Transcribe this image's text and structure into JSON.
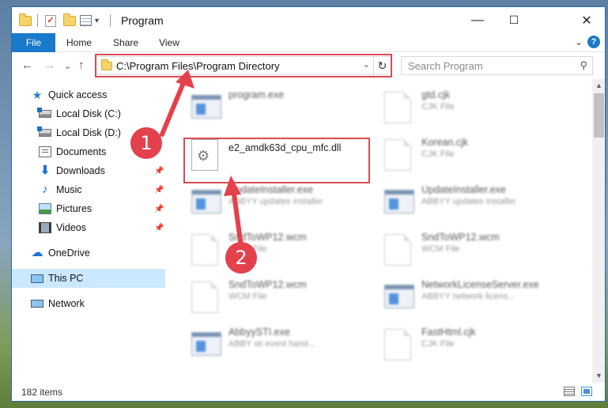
{
  "window": {
    "title": "Program",
    "controls": {
      "minimize": "—",
      "maximize": "☐",
      "close": "✕"
    }
  },
  "ribbon": {
    "tabs": [
      "File",
      "Home",
      "Share",
      "View"
    ],
    "expand_glyph": "⌄",
    "help_glyph": "?"
  },
  "navbar": {
    "back": "←",
    "forward": "→",
    "recent": "⌄",
    "up": "↑",
    "address": "C:\\Program Files\\Program Directory",
    "address_dropdown": "⌄",
    "refresh": "↻",
    "search_placeholder": "Search Program",
    "search_glyph": "⚲"
  },
  "sidebar": {
    "items": [
      {
        "label": "Quick access",
        "icon": "star-icon",
        "pinned": false
      },
      {
        "label": "Local Disk (C:)",
        "icon": "disk-icon",
        "pinned": false
      },
      {
        "label": "Local Disk (D:)",
        "icon": "disk-icon",
        "pinned": false
      },
      {
        "label": "Documents",
        "icon": "documents-icon",
        "pinned": false
      },
      {
        "label": "Downloads",
        "icon": "download-icon",
        "pinned": true
      },
      {
        "label": "Music",
        "icon": "music-icon",
        "pinned": true
      },
      {
        "label": "Pictures",
        "icon": "pictures-icon",
        "pinned": true
      },
      {
        "label": "Videos",
        "icon": "videos-icon",
        "pinned": true
      },
      {
        "label": "OneDrive",
        "icon": "cloud-icon",
        "pinned": false
      },
      {
        "label": "This PC",
        "icon": "computer-icon",
        "pinned": false,
        "selected": true
      },
      {
        "label": "Network",
        "icon": "network-icon",
        "pinned": false
      }
    ],
    "pin_glyph": "📌"
  },
  "files": [
    {
      "name": "program.exe",
      "desc": "",
      "icon": "exe-icon",
      "blurred": true
    },
    {
      "name": "gtd.cjk",
      "desc": "CJK File",
      "icon": "file-icon",
      "blurred": true
    },
    {
      "name": "e2_amdk63d_cpu_mfc.dll",
      "desc": "",
      "icon": "dll-icon",
      "blurred": false,
      "highlighted": true
    },
    {
      "name": "Korean.cjk",
      "desc": "CJK File",
      "icon": "file-icon",
      "blurred": true
    },
    {
      "name": "UpdateInstaller.exe",
      "desc": "ABBYY updates installer",
      "icon": "exe-icon",
      "blurred": true
    },
    {
      "name": "UpdateInstaller.exe",
      "desc": "ABBYY updates installer",
      "icon": "exe-icon",
      "blurred": true
    },
    {
      "name": "SndToWP12.wcm",
      "desc": "WCM File",
      "icon": "file-icon",
      "blurred": true
    },
    {
      "name": "SndToWP12.wcm",
      "desc": "WCM File",
      "icon": "file-icon",
      "blurred": true
    },
    {
      "name": "SndToWP12.wcm",
      "desc": "WCM File",
      "icon": "file-icon",
      "blurred": true
    },
    {
      "name": "NetworkLicenseServer.exe",
      "desc": "ABBYY network licens...",
      "icon": "exe-icon",
      "blurred": true
    },
    {
      "name": "AbbyySTI.exe",
      "desc": "ABBY sti event hand...",
      "icon": "exe-icon",
      "blurred": true
    },
    {
      "name": "FastHtml.cjk",
      "desc": "CJK File",
      "icon": "file-icon",
      "blurred": true
    }
  ],
  "status": {
    "item_count": "182 items"
  },
  "scrollbar": {
    "up": "▲",
    "down": "▼"
  },
  "annotations": {
    "step1": "1",
    "step2": "2",
    "color": "#e3414c"
  }
}
